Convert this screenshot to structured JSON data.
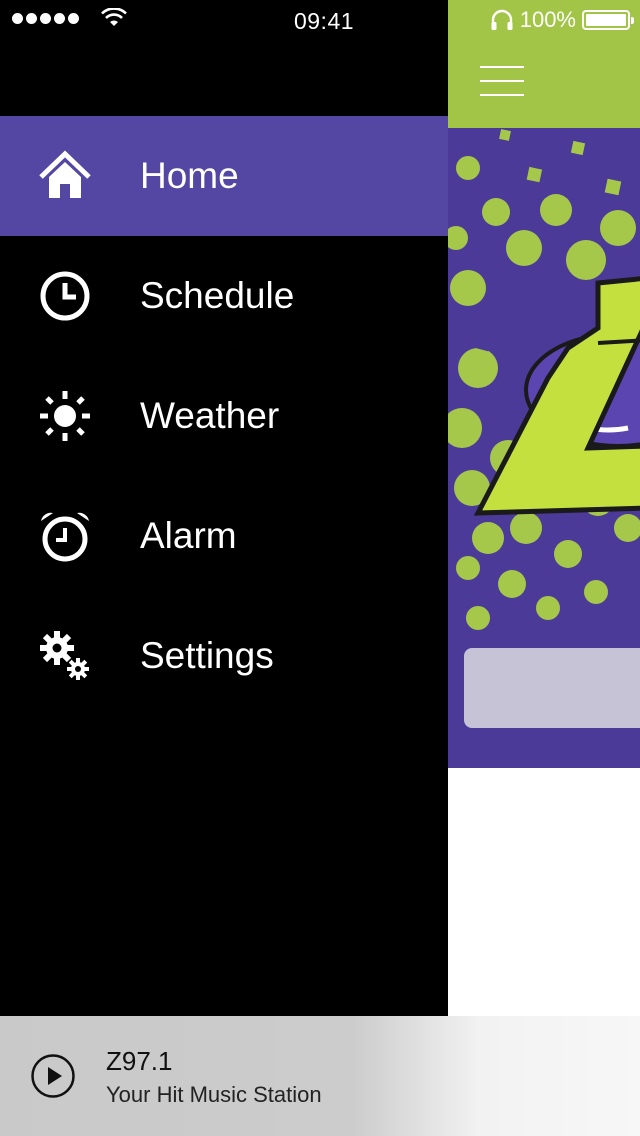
{
  "status_bar": {
    "time": "09:41",
    "battery": "100%",
    "signal_icon": "signal-dots-icon",
    "wifi_icon": "wifi-icon",
    "headphones_icon": "headphones-icon",
    "battery_icon": "battery-icon"
  },
  "colors": {
    "active_item": "#5447a3",
    "header_green": "#a2c548",
    "banner_purple": "#4c3a99",
    "drawer_bg": "#000000"
  },
  "menu": {
    "items": [
      {
        "label": "Home",
        "icon": "home-icon",
        "active": true
      },
      {
        "label": "Schedule",
        "icon": "clock-icon",
        "active": false
      },
      {
        "label": "Weather",
        "icon": "sun-icon",
        "active": false
      },
      {
        "label": "Alarm",
        "icon": "alarm-clock-icon",
        "active": false
      },
      {
        "label": "Settings",
        "icon": "gears-icon",
        "active": false
      }
    ]
  },
  "header": {
    "menu_icon": "hamburger-menu-icon"
  },
  "player": {
    "station": "Z97.1",
    "tagline": "Your Hit Music Station",
    "play_icon": "play-icon"
  }
}
